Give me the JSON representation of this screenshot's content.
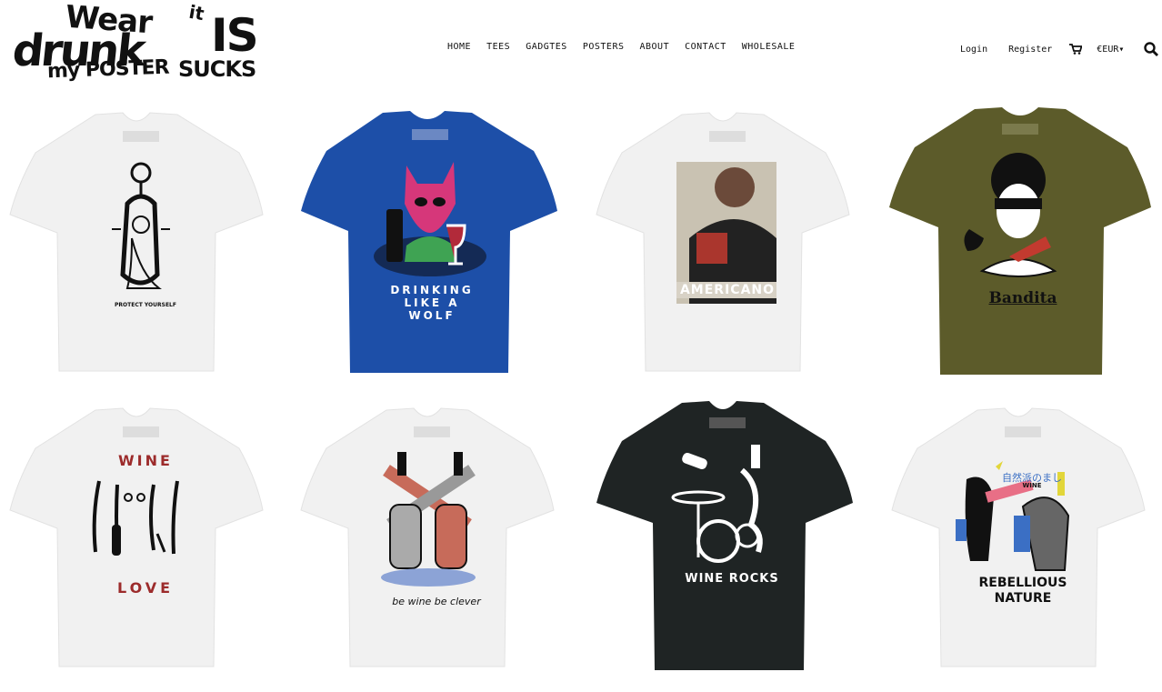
{
  "logo": {
    "line1": "Wear",
    "line1b": "it",
    "line2": "drunk",
    "line2b": "IS",
    "line3": "my POSTER",
    "line3b": "SUCKS"
  },
  "nav": [
    "HOME",
    "TEES",
    "GADGTES",
    "POSTERS",
    "ABOUT",
    "CONTACT",
    "WHOLESALE"
  ],
  "account": {
    "login": "Login",
    "register": "Register",
    "currency": "€EUR"
  },
  "icons": {
    "cart": "cart-icon",
    "search": "search-icon",
    "caret": "caret-down-icon"
  },
  "products": [
    {
      "color": "#f1f1f1",
      "print": "PROTECT YOURSELF",
      "print_color": "#111111"
    },
    {
      "color": "#1d4fa8",
      "print": "DRINKING LIKE A WOLF",
      "print_color": "#ffffff"
    },
    {
      "color": "#f1f1f1",
      "print": "AMERICANO",
      "print_color": "#ffffff"
    },
    {
      "color": "#5c5b2a",
      "print": "Bandita",
      "print_color": "#111111"
    },
    {
      "color": "#f1f1f1",
      "print": "WINE",
      "print2": "LOVE",
      "print_color": "#9c2b2b"
    },
    {
      "color": "#f1f1f1",
      "print": "be wine be clever",
      "print_color": "#111111"
    },
    {
      "color": "#1f2424",
      "print": "WINE ROCKS",
      "print_color": "#ffffff"
    },
    {
      "color": "#f1f1f1",
      "print": "REBELLIOUS NATURE",
      "print2": "自然派のまし",
      "print3": "WINE",
      "print_color": "#111111"
    }
  ]
}
